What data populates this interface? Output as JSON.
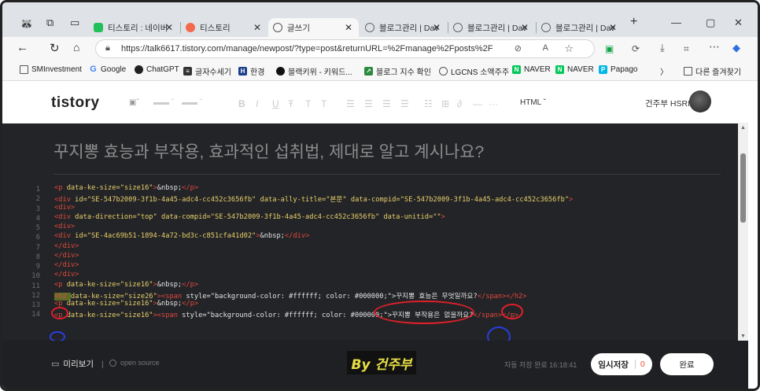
{
  "browser": {
    "tabs": [
      {
        "title": "티스토리 : 네이버",
        "favicon_color": "#21c05b"
      },
      {
        "title": "티스토리",
        "favicon_color": "#f26a4b"
      },
      {
        "title": "글쓰기",
        "favicon_color": "#555555"
      },
      {
        "title": "블로그관리 | Dav",
        "favicon_color": "#555555"
      },
      {
        "title": "블로그관리 | Dav",
        "favicon_color": "#555555"
      },
      {
        "title": "블로그관리 | Dav",
        "favicon_color": "#555555"
      }
    ],
    "new_tab": "+",
    "url": "https://talk6617.tistory.com/manage/newpost/?type=post&returnURL=%2Fmanage%2Fposts%2F",
    "bookmarks": [
      {
        "label": "SMInvestment",
        "icon": "folder-icon",
        "color": "#444444",
        "glyph": ""
      },
      {
        "label": "Google",
        "icon": "google-icon",
        "color": "#4285f4",
        "glyph": "G"
      },
      {
        "label": "ChatGPT",
        "icon": "chatgpt-icon",
        "color": "#222222",
        "glyph": "◎"
      },
      {
        "label": "글자수세기",
        "icon": "doc-icon",
        "color": "#333333",
        "glyph": "≡"
      },
      {
        "label": "한경",
        "icon": "hankyung-icon",
        "color": "#1a3e8c",
        "glyph": "H"
      },
      {
        "label": "블랙키위 - 키워드...",
        "icon": "blackkiwi-icon",
        "color": "#111111",
        "glyph": "●"
      },
      {
        "label": "블로그 지수 확인",
        "icon": "blog-index-icon",
        "color": "#2b8a3e",
        "glyph": "↗"
      },
      {
        "label": "LGCNS 소액주주",
        "icon": "globe-icon",
        "color": "#555555",
        "glyph": "⊕"
      },
      {
        "label": "NAVER",
        "icon": "naver-icon",
        "color": "#03c75a",
        "glyph": "N"
      },
      {
        "label": "NAVER",
        "icon": "naver-icon",
        "color": "#03c75a",
        "glyph": "N"
      },
      {
        "label": "Papago",
        "icon": "papago-icon",
        "color": "#00b7e6",
        "glyph": "P"
      }
    ],
    "other_bookmarks": "다른 즐겨찾기"
  },
  "editor": {
    "logo": "tistory",
    "toolbar_mode": "HTML",
    "user_name": "건주부 HSRI",
    "post_title": "꾸지뽕 효능과 부작용, 효과적인 섭취법, 제대로 알고 계시나요?",
    "line_numbers": [
      "1",
      "2",
      "3",
      "4",
      "5",
      "6",
      "7",
      "8",
      "9",
      "10",
      "11",
      "12",
      "13",
      "14"
    ]
  },
  "code_lines": [
    {
      "t1": "<p ",
      "a1": "data-ke-size=\"size16\"",
      "t2": ">",
      "x": "&nbsp;",
      "t3": "</p>"
    },
    {
      "t1": "<div ",
      "a1": "id=\"SE-547b2009-3f1b-4a45-adc4-cc452c3656fb\" data-ally-title=\"본문\" data-compid=\"SE-547b2009-3f1b-4a45-adc4-cc452c3656fb\"",
      "t2": ">",
      "x": "",
      "t3": ""
    },
    {
      "t1": "<div>",
      "a1": "",
      "t2": "",
      "x": "",
      "t3": ""
    },
    {
      "t1": "<div ",
      "a1": "data-direction=\"top\" data-compid=\"SE-547b2009-3f1b-4a45-adc4-cc452c3656fb\" data-unitid=\"\"",
      "t2": ">",
      "x": "",
      "t3": ""
    },
    {
      "t1": "<div>",
      "a1": "",
      "t2": "",
      "x": "",
      "t3": ""
    },
    {
      "t1": "<div ",
      "a1": "id=\"SE-4ac69b51-1894-4a72-bd3c-c851cfa41d02\"",
      "t2": ">",
      "x": "&nbsp;",
      "t3": "</div>"
    },
    {
      "t1": "</div>",
      "a1": "",
      "t2": "",
      "x": "",
      "t3": ""
    },
    {
      "t1": "</div>",
      "a1": "",
      "t2": "",
      "x": "",
      "t3": ""
    },
    {
      "t1": "</div>",
      "a1": "",
      "t2": "",
      "x": "",
      "t3": ""
    },
    {
      "t1": "</div>",
      "a1": "",
      "t2": "",
      "x": "",
      "t3": ""
    },
    {
      "t1": "<p ",
      "a1": "data-ke-size=\"size16\"",
      "t2": ">",
      "x": "&nbsp;",
      "t3": "</p>"
    },
    {
      "t1": "<h2 ",
      "a1": "data-ke-size=\"size26\"",
      "t2": "><span ",
      "x": "style=\"background-color: #ffffff; color: #000000;\">꾸지뽕 효능은 무엇일까요?",
      "t3": "</span></h2>"
    },
    {
      "t1": "<p ",
      "a1": "data-ke-size=\"size16\"",
      "t2": ">",
      "x": "&nbsp;",
      "t3": "</p>"
    },
    {
      "t1": "<p ",
      "a1": "data-ke-size=\"size16\"",
      "t2": "><span ",
      "x": "style=\"background-color: #ffffff; color: #000000;\">꾸지뽕 부작용은 없을까요?",
      "t3": "</span></p>"
    }
  ],
  "footer": {
    "preview": "미리보기",
    "open_source": "open source",
    "brand_text": "By 건주부",
    "autosave": "자동 저장 완료 16:18:41",
    "draft": "임시저장",
    "draft_count": "0",
    "publish": "완료"
  }
}
